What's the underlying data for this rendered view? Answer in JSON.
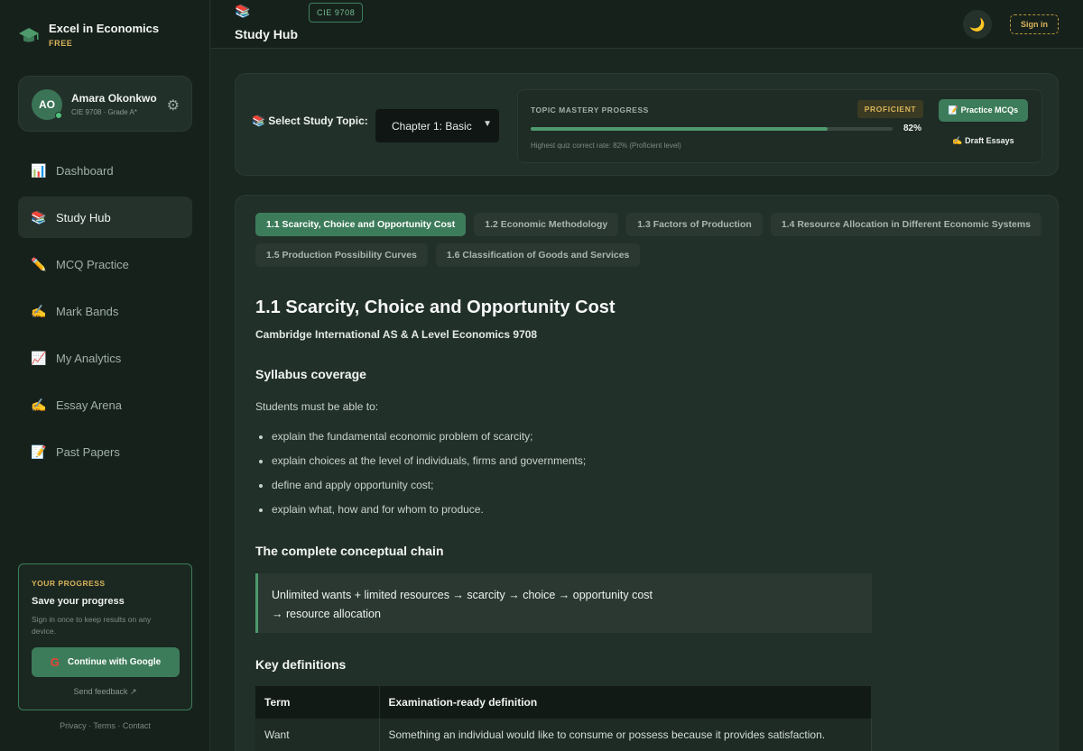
{
  "brand": {
    "title": "Excel in Economics",
    "tier": "FREE"
  },
  "profile": {
    "initials": "AO",
    "name": "Amara Okonkwo",
    "meta": "CIE 9708 · Grade A*"
  },
  "nav": [
    {
      "icon": "📊",
      "icon_name": "chart-icon",
      "label": "Dashboard",
      "active": false
    },
    {
      "icon": "📚",
      "icon_name": "books-icon",
      "label": "Study Hub",
      "active": true
    },
    {
      "icon": "✏️",
      "icon_name": "pencil-icon",
      "label": "MCQ Practice",
      "active": false
    },
    {
      "icon": "✍️",
      "icon_name": "writing-hand-icon",
      "label": "Mark Bands",
      "active": false
    },
    {
      "icon": "📈",
      "icon_name": "trend-icon",
      "label": "My Analytics",
      "active": false
    },
    {
      "icon": "✍️",
      "icon_name": "writing-hand-icon",
      "label": "Essay Arena",
      "active": false
    },
    {
      "icon": "📝",
      "icon_name": "memo-icon",
      "label": "Past Papers",
      "active": false
    }
  ],
  "progress_card": {
    "label": "YOUR PROGRESS",
    "title": "Save your progress",
    "desc": "Sign in once to keep results on any device.",
    "google_btn": "Continue with Google",
    "feedback": "Send feedback ↗"
  },
  "legal": "Privacy · Terms · Contact",
  "header": {
    "title": "Study Hub",
    "badge": "CIE 9708",
    "signin": "Sign in"
  },
  "topic": {
    "label": "📚 Select Study Topic:",
    "selected": "Chapter 1: Basic",
    "mastery_title": "TOPIC MASTERY PROGRESS",
    "level": "PROFICIENT",
    "progress": 0.82,
    "pct_label": "82%",
    "note": "Highest quiz correct rate: 82% (Proficient level)",
    "practice_btn": "📝 Practice MCQs",
    "draft_btn": "✍️ Draft Essays"
  },
  "tabs": [
    {
      "label": "1.1  Scarcity, Choice and Opportunity Cost",
      "active": true
    },
    {
      "label": "1.2  Economic Methodology",
      "active": false
    },
    {
      "label": "1.3  Factors of Production",
      "active": false
    },
    {
      "label": "1.4  Resource Allocation in Different Economic Systems",
      "active": false
    },
    {
      "label": "1.5  Production Possibility Curves",
      "active": false
    },
    {
      "label": "1.6  Classification of Goods and Services",
      "active": false
    }
  ],
  "lesson": {
    "title": "1.1 Scarcity, Choice and Opportunity Cost",
    "subtitle": "Cambridge International AS & A Level Economics 9708",
    "syllabus_heading": "Syllabus coverage",
    "intro": "Students must be able to:",
    "bullets": [
      "explain the fundamental economic problem of scarcity;",
      "explain choices at the level of individuals, firms and governments;",
      "define and apply opportunity cost;",
      "explain what, how and for whom to produce."
    ],
    "chain_heading": "The complete conceptual chain",
    "chain_line1": "Unlimited wants + limited resources → scarcity → choice → opportunity cost",
    "chain_line2": "→ resource allocation",
    "definitions_heading": "Key definitions",
    "table_headers": [
      "Term",
      "Examination-ready definition"
    ],
    "table_rows": [
      [
        "Want",
        "Something an individual would like to consume or possess because it provides satisfaction."
      ]
    ]
  }
}
